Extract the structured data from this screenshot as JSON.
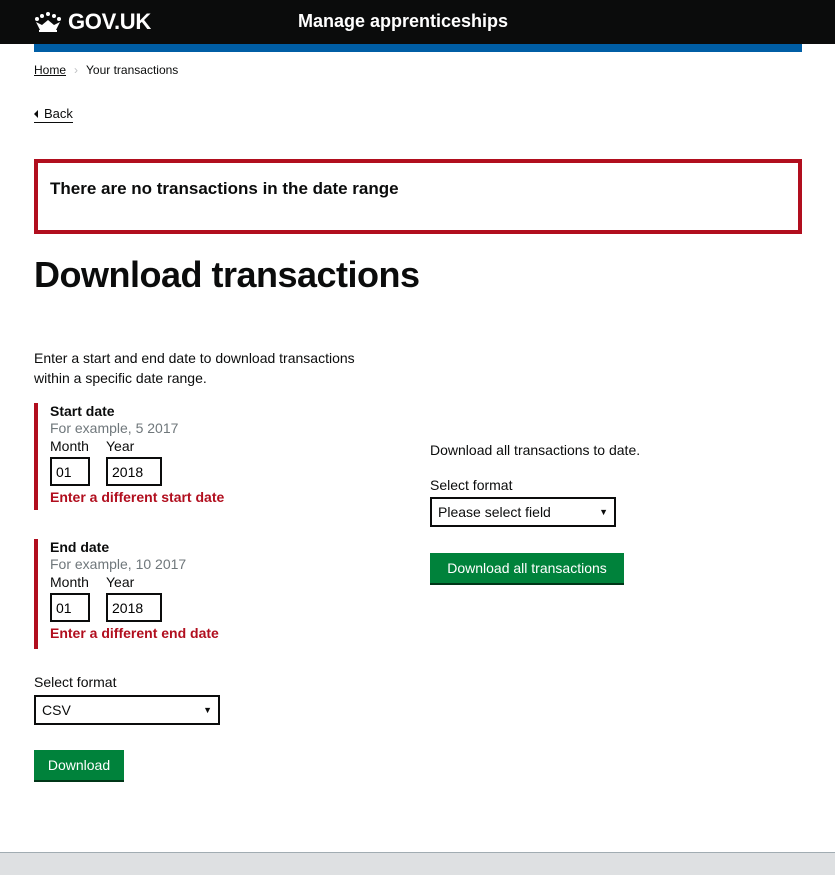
{
  "header": {
    "logo_text": "GOV.UK",
    "service_name": "Manage apprenticeships"
  },
  "breadcrumbs": {
    "home": "Home",
    "current": "Your transactions"
  },
  "back_link": "Back",
  "error_summary": {
    "title": "There are no transactions in the date range"
  },
  "page_title": "Download transactions",
  "intro": "Enter a start and end date to download transactions within a specific date range.",
  "start_date": {
    "legend": "Start date",
    "hint": "For example, 5 2017",
    "month_label": "Month",
    "year_label": "Year",
    "month_value": "01",
    "year_value": "2018",
    "error": "Enter a different start date"
  },
  "end_date": {
    "legend": "End date",
    "hint": "For example, 10 2017",
    "month_label": "Month",
    "year_label": "Year",
    "month_value": "01",
    "year_value": "2018",
    "error": "Enter a different end date"
  },
  "format_select": {
    "label": "Select format",
    "value": "CSV"
  },
  "download_button": "Download",
  "download_all": {
    "description": "Download all transactions to date.",
    "format_label": "Select format",
    "format_value": "Please select field",
    "button": "Download all transactions"
  },
  "colors": {
    "header_bg": "#0b0c0c",
    "blue_bar": "#005ea5",
    "error": "#b10e1e",
    "button_green": "#00823b"
  }
}
